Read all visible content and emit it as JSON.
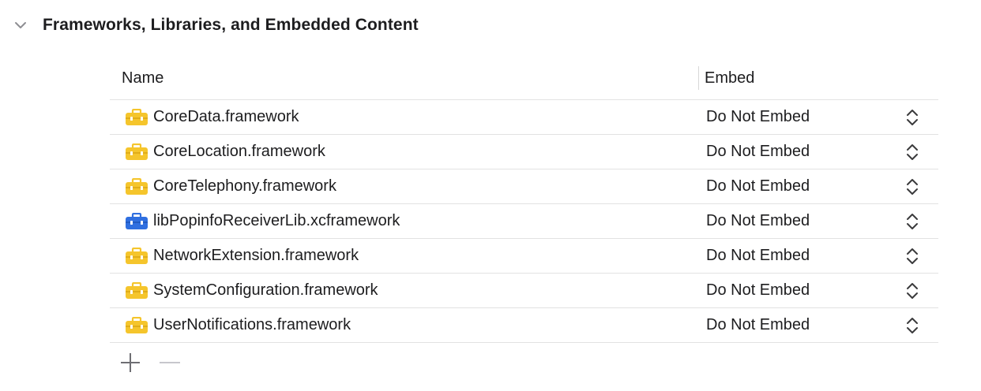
{
  "section": {
    "title": "Frameworks, Libraries, and Embedded Content",
    "disclosure_icon": "chevron-down-icon"
  },
  "table": {
    "columns": {
      "name": "Name",
      "embed": "Embed"
    },
    "rows": [
      {
        "name": "CoreData.framework",
        "embed": "Do Not Embed",
        "icon": "framework-toolbox-icon",
        "icon_color": "#f5c52c"
      },
      {
        "name": "CoreLocation.framework",
        "embed": "Do Not Embed",
        "icon": "framework-toolbox-icon",
        "icon_color": "#f5c52c"
      },
      {
        "name": "CoreTelephony.framework",
        "embed": "Do Not Embed",
        "icon": "framework-toolbox-icon",
        "icon_color": "#f5c52c"
      },
      {
        "name": "libPopinfoReceiverLib.xcframework",
        "embed": "Do Not Embed",
        "icon": "xcframework-toolbox-icon",
        "icon_color": "#2f6fe0"
      },
      {
        "name": "NetworkExtension.framework",
        "embed": "Do Not Embed",
        "icon": "framework-toolbox-icon",
        "icon_color": "#f5c52c"
      },
      {
        "name": "SystemConfiguration.framework",
        "embed": "Do Not Embed",
        "icon": "framework-toolbox-icon",
        "icon_color": "#f5c52c"
      },
      {
        "name": "UserNotifications.framework",
        "embed": "Do Not Embed",
        "icon": "framework-toolbox-icon",
        "icon_color": "#f5c52c"
      }
    ]
  },
  "toolbar": {
    "add_icon": "plus-icon",
    "remove_icon": "minus-icon"
  },
  "colors": {
    "framework": "#f5c52c",
    "xcframework": "#2f6fe0",
    "separator": "#e2e2e2",
    "text": "#1d1d1f"
  }
}
